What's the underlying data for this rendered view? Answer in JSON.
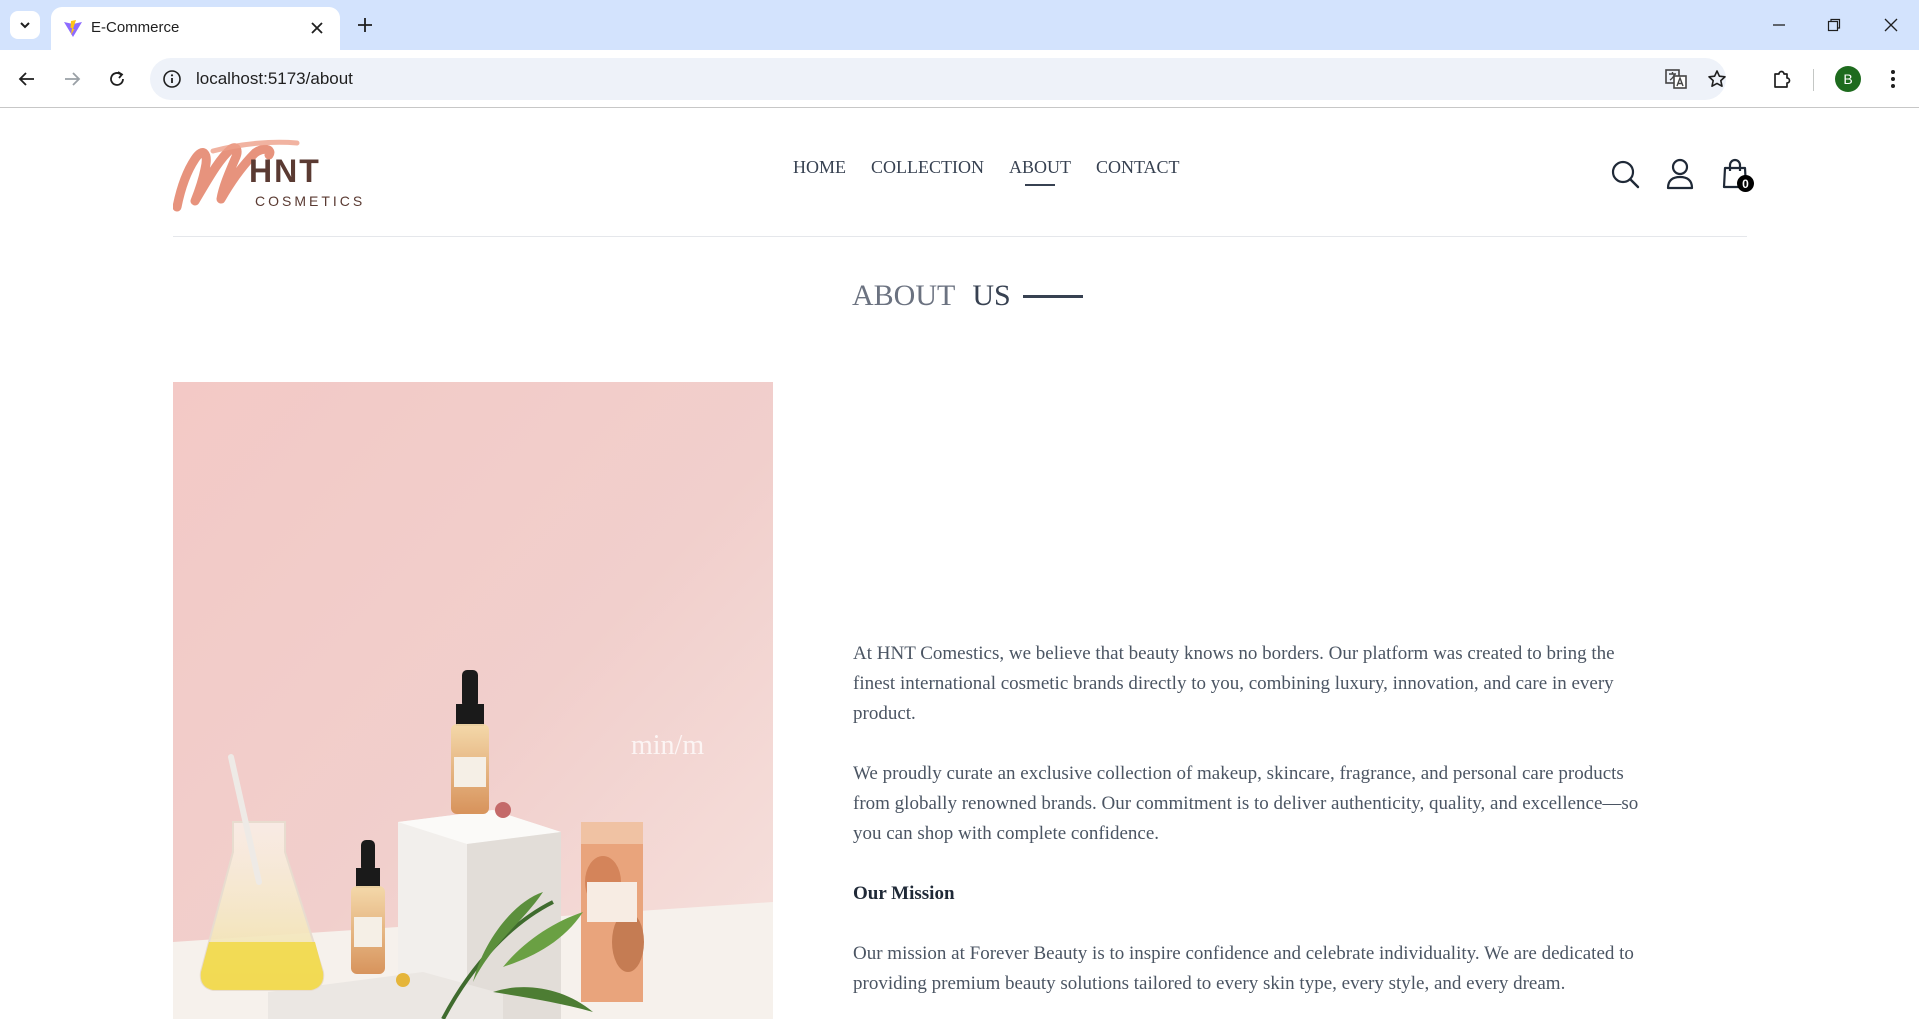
{
  "browser": {
    "tab_title": "E-Commerce",
    "url": "localhost:5173/about",
    "profile_initial": "B"
  },
  "header": {
    "logo_brand": "HNT",
    "logo_sub": "COSMETICS",
    "nav": [
      {
        "label": "HOME",
        "active": false
      },
      {
        "label": "COLLECTION",
        "active": false
      },
      {
        "label": "ABOUT",
        "active": true
      },
      {
        "label": "CONTACT",
        "active": false
      }
    ],
    "cart_count": "0"
  },
  "about": {
    "title_light": "ABOUT",
    "title_dark": "US",
    "image_watermark": "min/m",
    "paragraph_1": "At HNT Comestics, we believe that beauty knows no borders. Our platform was created to bring the finest international cosmetic brands directly to you, combining luxury, innovation, and care in every product.",
    "paragraph_2": "We proudly curate an exclusive collection of makeup, skincare, fragrance, and personal care products from globally renowned brands. Our commitment is to deliver authenticity, quality, and excellence—so you can shop with complete confidence.",
    "mission_heading": "Our Mission",
    "mission_text": "Our mission at Forever Beauty is to inspire confidence and celebrate individuality. We are dedicated to providing premium beauty solutions tailored to every skin type, every style, and every dream."
  },
  "colors": {
    "browser_tabbar": "#d3e3fd",
    "text_primary": "#374151",
    "text_secondary": "#4b5563",
    "logo_accent": "#e58a72",
    "logo_text": "#5a3a32"
  }
}
